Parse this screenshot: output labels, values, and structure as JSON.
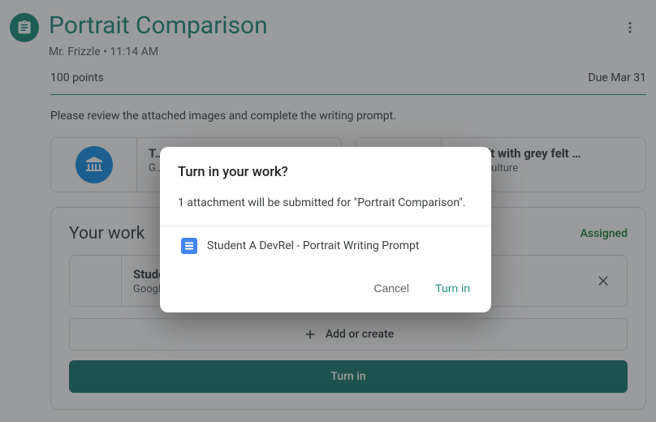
{
  "header": {
    "title": "Portrait Comparison",
    "author": "Mr. Frizzle",
    "time": "11:14 AM",
    "byline": "Mr. Frizzle • 11:14 AM"
  },
  "meta": {
    "points": "100 points",
    "due": "Due Mar 31"
  },
  "description": "Please review the attached images and complete the writing prompt.",
  "attachments": [
    {
      "title": "T…",
      "source": "G…"
    },
    {
      "title": "Portrait with grey felt …",
      "source": "Arts & Culture"
    }
  ],
  "work": {
    "heading": "Your work",
    "status": "Assigned",
    "attachment": {
      "title": "Studer…",
      "source": "Google …"
    },
    "add_create_label": "Add or create",
    "turn_in_label": "Turn in"
  },
  "dialog": {
    "title": "Turn in your work?",
    "body": "1 attachment will be submitted for \"Portrait Comparison\".",
    "attachment_name": "Student A DevRel - Portrait Writing Prompt",
    "cancel_label": "Cancel",
    "confirm_label": "Turn in"
  }
}
